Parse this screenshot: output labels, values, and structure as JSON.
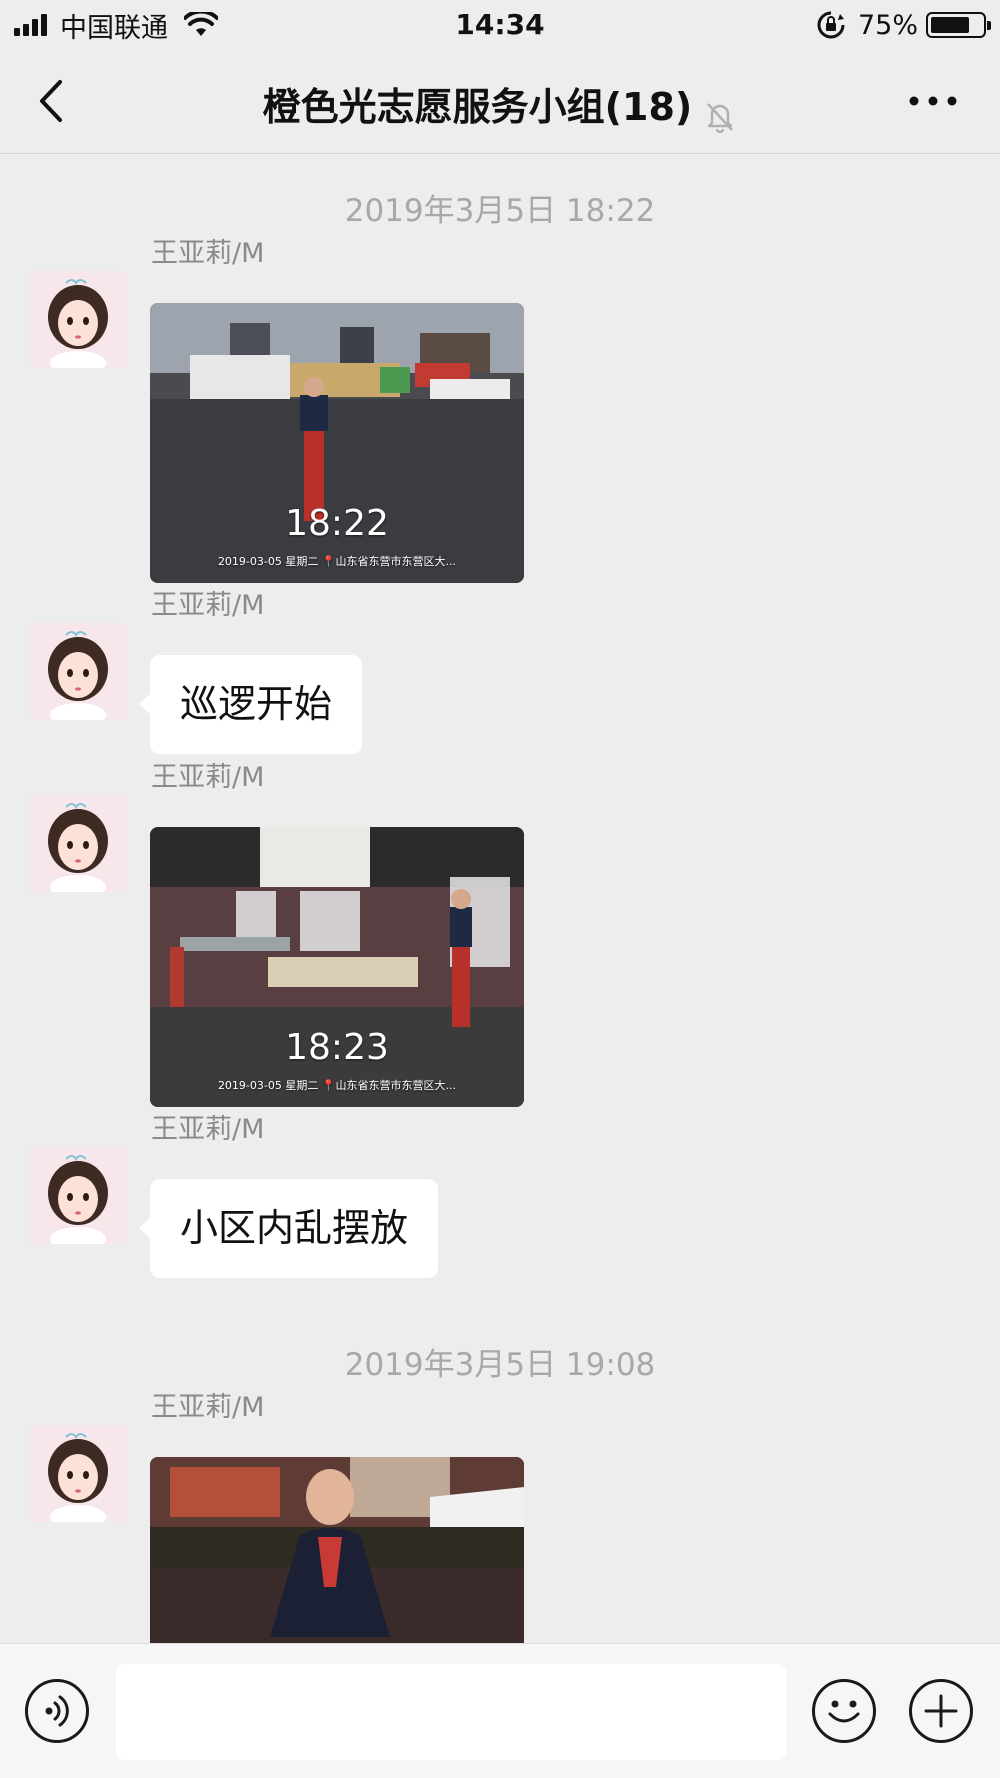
{
  "status_bar": {
    "carrier": "中国联通",
    "time": "14:34",
    "battery": "75%"
  },
  "nav": {
    "title": "橙色光志愿服务小组(18)",
    "back_icon": "chevron-left-icon",
    "mute_icon": "bell-off-icon",
    "more_icon": "more-dots-icon"
  },
  "messages": [
    {
      "type": "timestamp",
      "text": "2019年3月5日 18:22"
    },
    {
      "type": "image",
      "sender": "王亚莉/M",
      "overlay_time": "18:22",
      "overlay_meta": "2019-03-05  星期二 📍山东省东营市东营区大..."
    },
    {
      "type": "text",
      "sender": "王亚莉/M",
      "text": "巡逻开始"
    },
    {
      "type": "image",
      "sender": "王亚莉/M",
      "overlay_time": "18:23",
      "overlay_meta": "2019-03-05  星期二 📍山东省东营市东营区大..."
    },
    {
      "type": "text",
      "sender": "王亚莉/M",
      "text": "小区内乱摆放"
    },
    {
      "type": "timestamp",
      "text": "2019年3月5日 19:08"
    },
    {
      "type": "image",
      "sender": "王亚莉/M"
    }
  ],
  "input_bar": {
    "voice_icon": "voice-icon",
    "emoji_icon": "emoji-icon",
    "plus_icon": "plus-icon",
    "text_value": ""
  }
}
